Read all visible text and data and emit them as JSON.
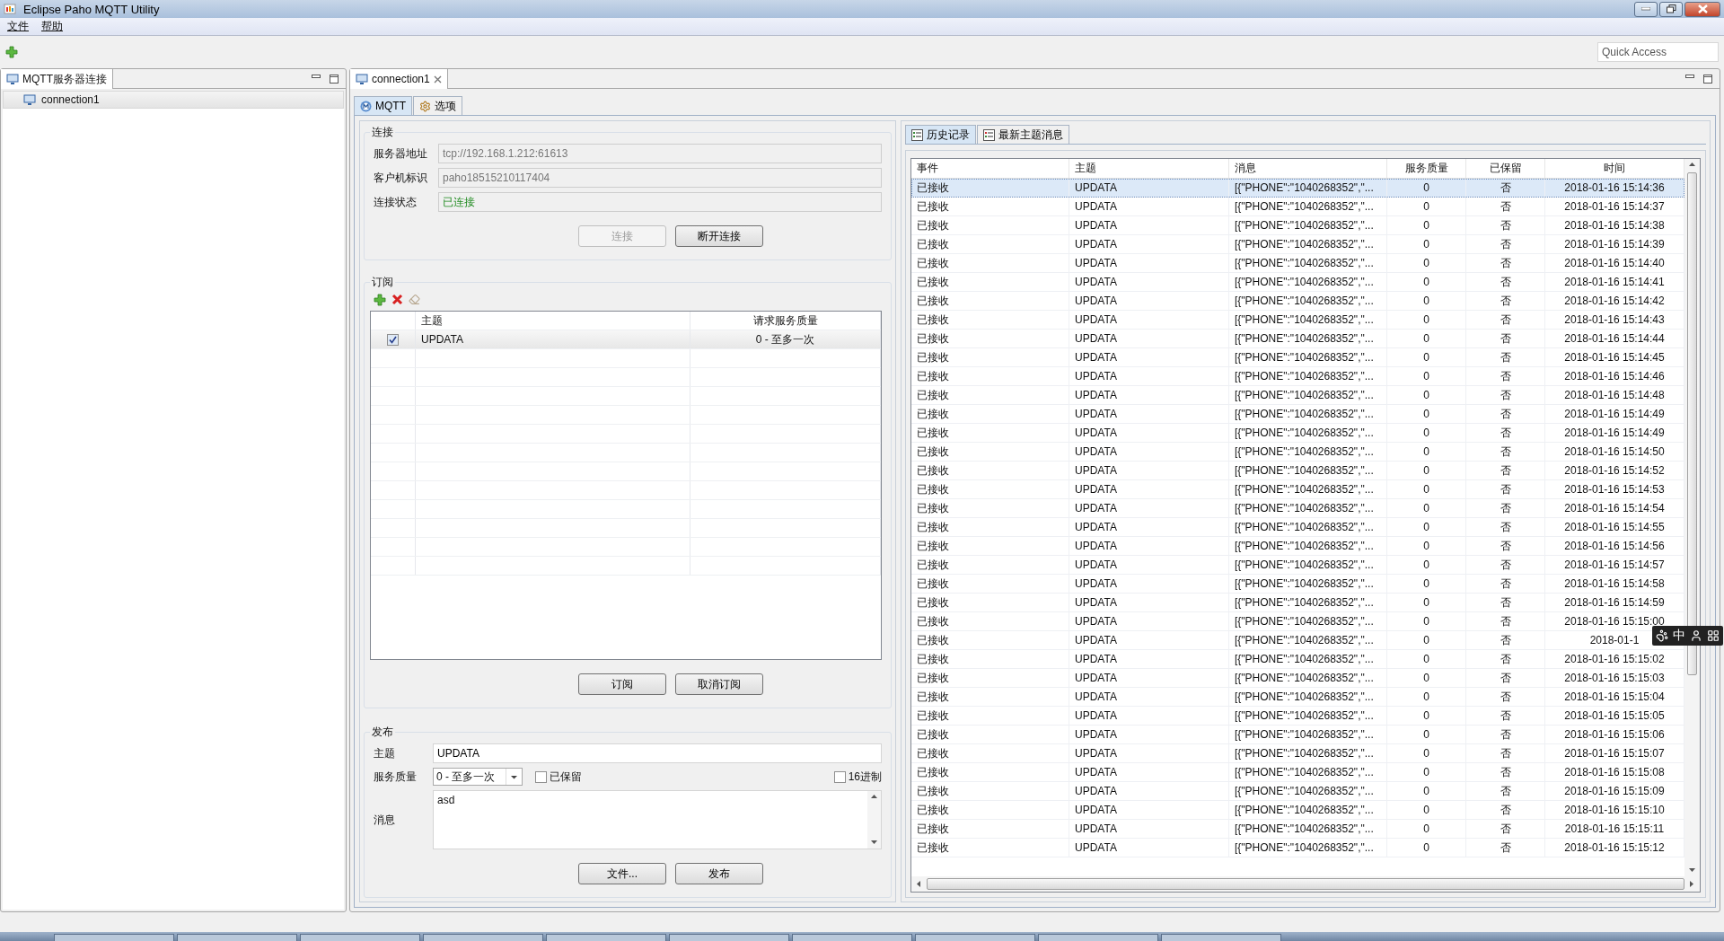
{
  "window": {
    "title": "Eclipse Paho MQTT Utility"
  },
  "menu": [
    {
      "label": "文件"
    },
    {
      "label": "帮助"
    }
  ],
  "quick_access": {
    "placeholder": "Quick Access"
  },
  "connections_panel": {
    "title": "MQTT服务器连接",
    "items": [
      {
        "label": "connection1",
        "selected": true
      }
    ]
  },
  "editor_tab": {
    "label": "connection1"
  },
  "subtabs": [
    {
      "label": "MQTT",
      "selected": true,
      "kind": "mqtt"
    },
    {
      "label": "选项",
      "selected": false,
      "kind": "options"
    }
  ],
  "connection": {
    "title": "连接",
    "fields": [
      {
        "label": "服务器地址",
        "value": "tcp://192.168.1.212:61613"
      },
      {
        "label": "客户机标识",
        "value": "paho18515210117404"
      }
    ],
    "status_label": "连接状态",
    "status": "已连接",
    "connected": true,
    "buttons": [
      {
        "label": "连接",
        "disabled": true
      },
      {
        "label": "断开连接",
        "disabled": false
      }
    ]
  },
  "subscriptions": {
    "title": "订阅",
    "columns": [
      "主题",
      "请求服务质量"
    ],
    "rows": [
      {
        "checked": true,
        "topic": "UPDATA",
        "qos": "0 - 至多一次"
      }
    ],
    "buttons": [
      {
        "label": "订阅"
      },
      {
        "label": "取消订阅"
      }
    ]
  },
  "publish": {
    "title": "发布",
    "topic_label": "主题",
    "topic": "UPDATA",
    "qos_label": "服务质量",
    "qos": "0 - 至多一次",
    "retained": {
      "label": "已保留",
      "checked": false
    },
    "hex": {
      "label": "16进制",
      "checked": false
    },
    "message_label": "消息",
    "message": "asd",
    "buttons": [
      {
        "label": "文件..."
      },
      {
        "label": "发布"
      }
    ]
  },
  "history_tabs": [
    {
      "label": "历史记录",
      "selected": true,
      "kind": "history"
    },
    {
      "label": "最新主题消息",
      "selected": false,
      "kind": "latest"
    }
  ],
  "history": {
    "columns": [
      "事件",
      "主题",
      "消息",
      "服务质量",
      "已保留",
      "时间"
    ],
    "rows": [
      {
        "event": "已接收",
        "topic": "UPDATA",
        "message": "[{\"PHONE\":\"1040268352\",\"...",
        "qos": "0",
        "retained": "否",
        "time": "2018-01-16 15:14:36",
        "selected": true
      },
      {
        "event": "已接收",
        "topic": "UPDATA",
        "message": "[{\"PHONE\":\"1040268352\",\"...",
        "qos": "0",
        "retained": "否",
        "time": "2018-01-16 15:14:37",
        "selected": false
      },
      {
        "event": "已接收",
        "topic": "UPDATA",
        "message": "[{\"PHONE\":\"1040268352\",\"...",
        "qos": "0",
        "retained": "否",
        "time": "2018-01-16 15:14:38",
        "selected": false
      },
      {
        "event": "已接收",
        "topic": "UPDATA",
        "message": "[{\"PHONE\":\"1040268352\",\"...",
        "qos": "0",
        "retained": "否",
        "time": "2018-01-16 15:14:39",
        "selected": false
      },
      {
        "event": "已接收",
        "topic": "UPDATA",
        "message": "[{\"PHONE\":\"1040268352\",\"...",
        "qos": "0",
        "retained": "否",
        "time": "2018-01-16 15:14:40",
        "selected": false
      },
      {
        "event": "已接收",
        "topic": "UPDATA",
        "message": "[{\"PHONE\":\"1040268352\",\"...",
        "qos": "0",
        "retained": "否",
        "time": "2018-01-16 15:14:41",
        "selected": false
      },
      {
        "event": "已接收",
        "topic": "UPDATA",
        "message": "[{\"PHONE\":\"1040268352\",\"...",
        "qos": "0",
        "retained": "否",
        "time": "2018-01-16 15:14:42",
        "selected": false
      },
      {
        "event": "已接收",
        "topic": "UPDATA",
        "message": "[{\"PHONE\":\"1040268352\",\"...",
        "qos": "0",
        "retained": "否",
        "time": "2018-01-16 15:14:43",
        "selected": false
      },
      {
        "event": "已接收",
        "topic": "UPDATA",
        "message": "[{\"PHONE\":\"1040268352\",\"...",
        "qos": "0",
        "retained": "否",
        "time": "2018-01-16 15:14:44",
        "selected": false
      },
      {
        "event": "已接收",
        "topic": "UPDATA",
        "message": "[{\"PHONE\":\"1040268352\",\"...",
        "qos": "0",
        "retained": "否",
        "time": "2018-01-16 15:14:45",
        "selected": false
      },
      {
        "event": "已接收",
        "topic": "UPDATA",
        "message": "[{\"PHONE\":\"1040268352\",\"...",
        "qos": "0",
        "retained": "否",
        "time": "2018-01-16 15:14:46",
        "selected": false
      },
      {
        "event": "已接收",
        "topic": "UPDATA",
        "message": "[{\"PHONE\":\"1040268352\",\"...",
        "qos": "0",
        "retained": "否",
        "time": "2018-01-16 15:14:48",
        "selected": false
      },
      {
        "event": "已接收",
        "topic": "UPDATA",
        "message": "[{\"PHONE\":\"1040268352\",\"...",
        "qos": "0",
        "retained": "否",
        "time": "2018-01-16 15:14:49",
        "selected": false
      },
      {
        "event": "已接收",
        "topic": "UPDATA",
        "message": "[{\"PHONE\":\"1040268352\",\"...",
        "qos": "0",
        "retained": "否",
        "time": "2018-01-16 15:14:49",
        "selected": false
      },
      {
        "event": "已接收",
        "topic": "UPDATA",
        "message": "[{\"PHONE\":\"1040268352\",\"...",
        "qos": "0",
        "retained": "否",
        "time": "2018-01-16 15:14:50",
        "selected": false
      },
      {
        "event": "已接收",
        "topic": "UPDATA",
        "message": "[{\"PHONE\":\"1040268352\",\"...",
        "qos": "0",
        "retained": "否",
        "time": "2018-01-16 15:14:52",
        "selected": false
      },
      {
        "event": "已接收",
        "topic": "UPDATA",
        "message": "[{\"PHONE\":\"1040268352\",\"...",
        "qos": "0",
        "retained": "否",
        "time": "2018-01-16 15:14:53",
        "selected": false
      },
      {
        "event": "已接收",
        "topic": "UPDATA",
        "message": "[{\"PHONE\":\"1040268352\",\"...",
        "qos": "0",
        "retained": "否",
        "time": "2018-01-16 15:14:54",
        "selected": false
      },
      {
        "event": "已接收",
        "topic": "UPDATA",
        "message": "[{\"PHONE\":\"1040268352\",\"...",
        "qos": "0",
        "retained": "否",
        "time": "2018-01-16 15:14:55",
        "selected": false
      },
      {
        "event": "已接收",
        "topic": "UPDATA",
        "message": "[{\"PHONE\":\"1040268352\",\"...",
        "qos": "0",
        "retained": "否",
        "time": "2018-01-16 15:14:56",
        "selected": false
      },
      {
        "event": "已接收",
        "topic": "UPDATA",
        "message": "[{\"PHONE\":\"1040268352\",\"...",
        "qos": "0",
        "retained": "否",
        "time": "2018-01-16 15:14:57",
        "selected": false
      },
      {
        "event": "已接收",
        "topic": "UPDATA",
        "message": "[{\"PHONE\":\"1040268352\",\"...",
        "qos": "0",
        "retained": "否",
        "time": "2018-01-16 15:14:58",
        "selected": false
      },
      {
        "event": "已接收",
        "topic": "UPDATA",
        "message": "[{\"PHONE\":\"1040268352\",\"...",
        "qos": "0",
        "retained": "否",
        "time": "2018-01-16 15:14:59",
        "selected": false
      },
      {
        "event": "已接收",
        "topic": "UPDATA",
        "message": "[{\"PHONE\":\"1040268352\",\"...",
        "qos": "0",
        "retained": "否",
        "time": "2018-01-16 15:15:00",
        "selected": false
      },
      {
        "event": "已接收",
        "topic": "UPDATA",
        "message": "[{\"PHONE\":\"1040268352\",\"...",
        "qos": "0",
        "retained": "否",
        "time": "2018-01-1",
        "selected": false
      },
      {
        "event": "已接收",
        "topic": "UPDATA",
        "message": "[{\"PHONE\":\"1040268352\",\"...",
        "qos": "0",
        "retained": "否",
        "time": "2018-01-16 15:15:02",
        "selected": false
      },
      {
        "event": "已接收",
        "topic": "UPDATA",
        "message": "[{\"PHONE\":\"1040268352\",\"...",
        "qos": "0",
        "retained": "否",
        "time": "2018-01-16 15:15:03",
        "selected": false
      },
      {
        "event": "已接收",
        "topic": "UPDATA",
        "message": "[{\"PHONE\":\"1040268352\",\"...",
        "qos": "0",
        "retained": "否",
        "time": "2018-01-16 15:15:04",
        "selected": false
      },
      {
        "event": "已接收",
        "topic": "UPDATA",
        "message": "[{\"PHONE\":\"1040268352\",\"...",
        "qos": "0",
        "retained": "否",
        "time": "2018-01-16 15:15:05",
        "selected": false
      },
      {
        "event": "已接收",
        "topic": "UPDATA",
        "message": "[{\"PHONE\":\"1040268352\",\"...",
        "qos": "0",
        "retained": "否",
        "time": "2018-01-16 15:15:06",
        "selected": false
      },
      {
        "event": "已接收",
        "topic": "UPDATA",
        "message": "[{\"PHONE\":\"1040268352\",\"...",
        "qos": "0",
        "retained": "否",
        "time": "2018-01-16 15:15:07",
        "selected": false
      },
      {
        "event": "已接收",
        "topic": "UPDATA",
        "message": "[{\"PHONE\":\"1040268352\",\"...",
        "qos": "0",
        "retained": "否",
        "time": "2018-01-16 15:15:08",
        "selected": false
      },
      {
        "event": "已接收",
        "topic": "UPDATA",
        "message": "[{\"PHONE\":\"1040268352\",\"...",
        "qos": "0",
        "retained": "否",
        "time": "2018-01-16 15:15:09",
        "selected": false
      },
      {
        "event": "已接收",
        "topic": "UPDATA",
        "message": "[{\"PHONE\":\"1040268352\",\"...",
        "qos": "0",
        "retained": "否",
        "time": "2018-01-16 15:15:10",
        "selected": false
      },
      {
        "event": "已接收",
        "topic": "UPDATA",
        "message": "[{\"PHONE\":\"1040268352\",\"...",
        "qos": "0",
        "retained": "否",
        "time": "2018-01-16 15:15:11",
        "selected": false
      },
      {
        "event": "已接收",
        "topic": "UPDATA",
        "message": "[{\"PHONE\":\"1040268352\",\"...",
        "qos": "0",
        "retained": "否",
        "time": "2018-01-16 15:15:12",
        "selected": false
      }
    ]
  },
  "ime_toolbar": {
    "mode": "中"
  }
}
